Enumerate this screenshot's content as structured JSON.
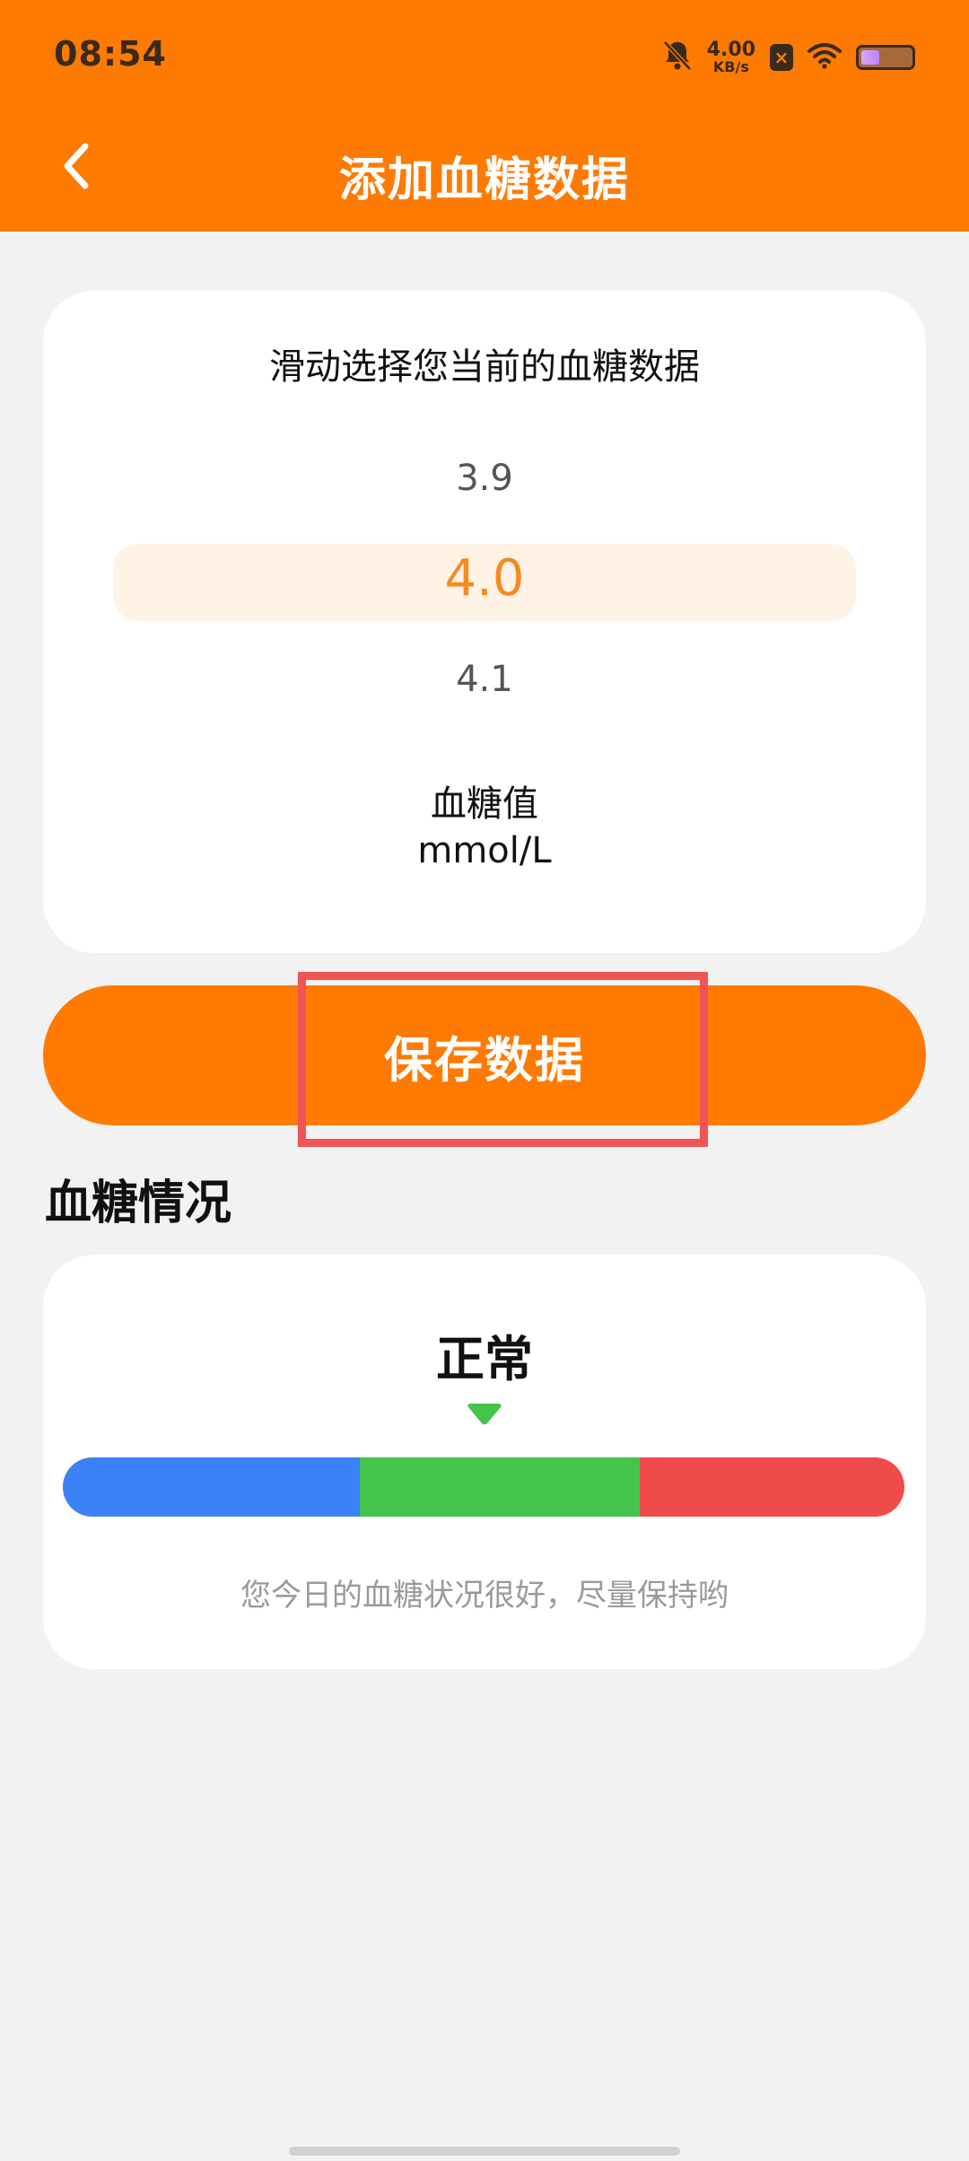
{
  "status_bar": {
    "time": "08:54",
    "net_speed_value": "4.00",
    "net_speed_unit": "KB/s",
    "icons": [
      "mute-bell-icon",
      "close-box-icon",
      "wifi-icon",
      "battery-icon"
    ]
  },
  "nav": {
    "back_icon": "chevron-left-icon",
    "title": "添加血糖数据"
  },
  "picker": {
    "hint": "滑动选择您当前的血糖数据",
    "prev_value": "3.9",
    "selected_value": "4.0",
    "next_value": "4.1",
    "label": "血糖值",
    "unit": "mmol/L"
  },
  "save_button": {
    "label": "保存数据"
  },
  "status_section": {
    "title": "血糖情况",
    "status": "正常",
    "tip": "您今日的血糖状况很好，尽量保持哟",
    "levels": [
      {
        "color": "#3b82f6"
      },
      {
        "color": "#45c44b"
      },
      {
        "color": "#ef4b4b"
      }
    ],
    "marker_color": "#45c44b"
  },
  "colors": {
    "accent": "#ff7a00",
    "selected_text": "#f58a1f",
    "highlight_box": "#f05454"
  }
}
